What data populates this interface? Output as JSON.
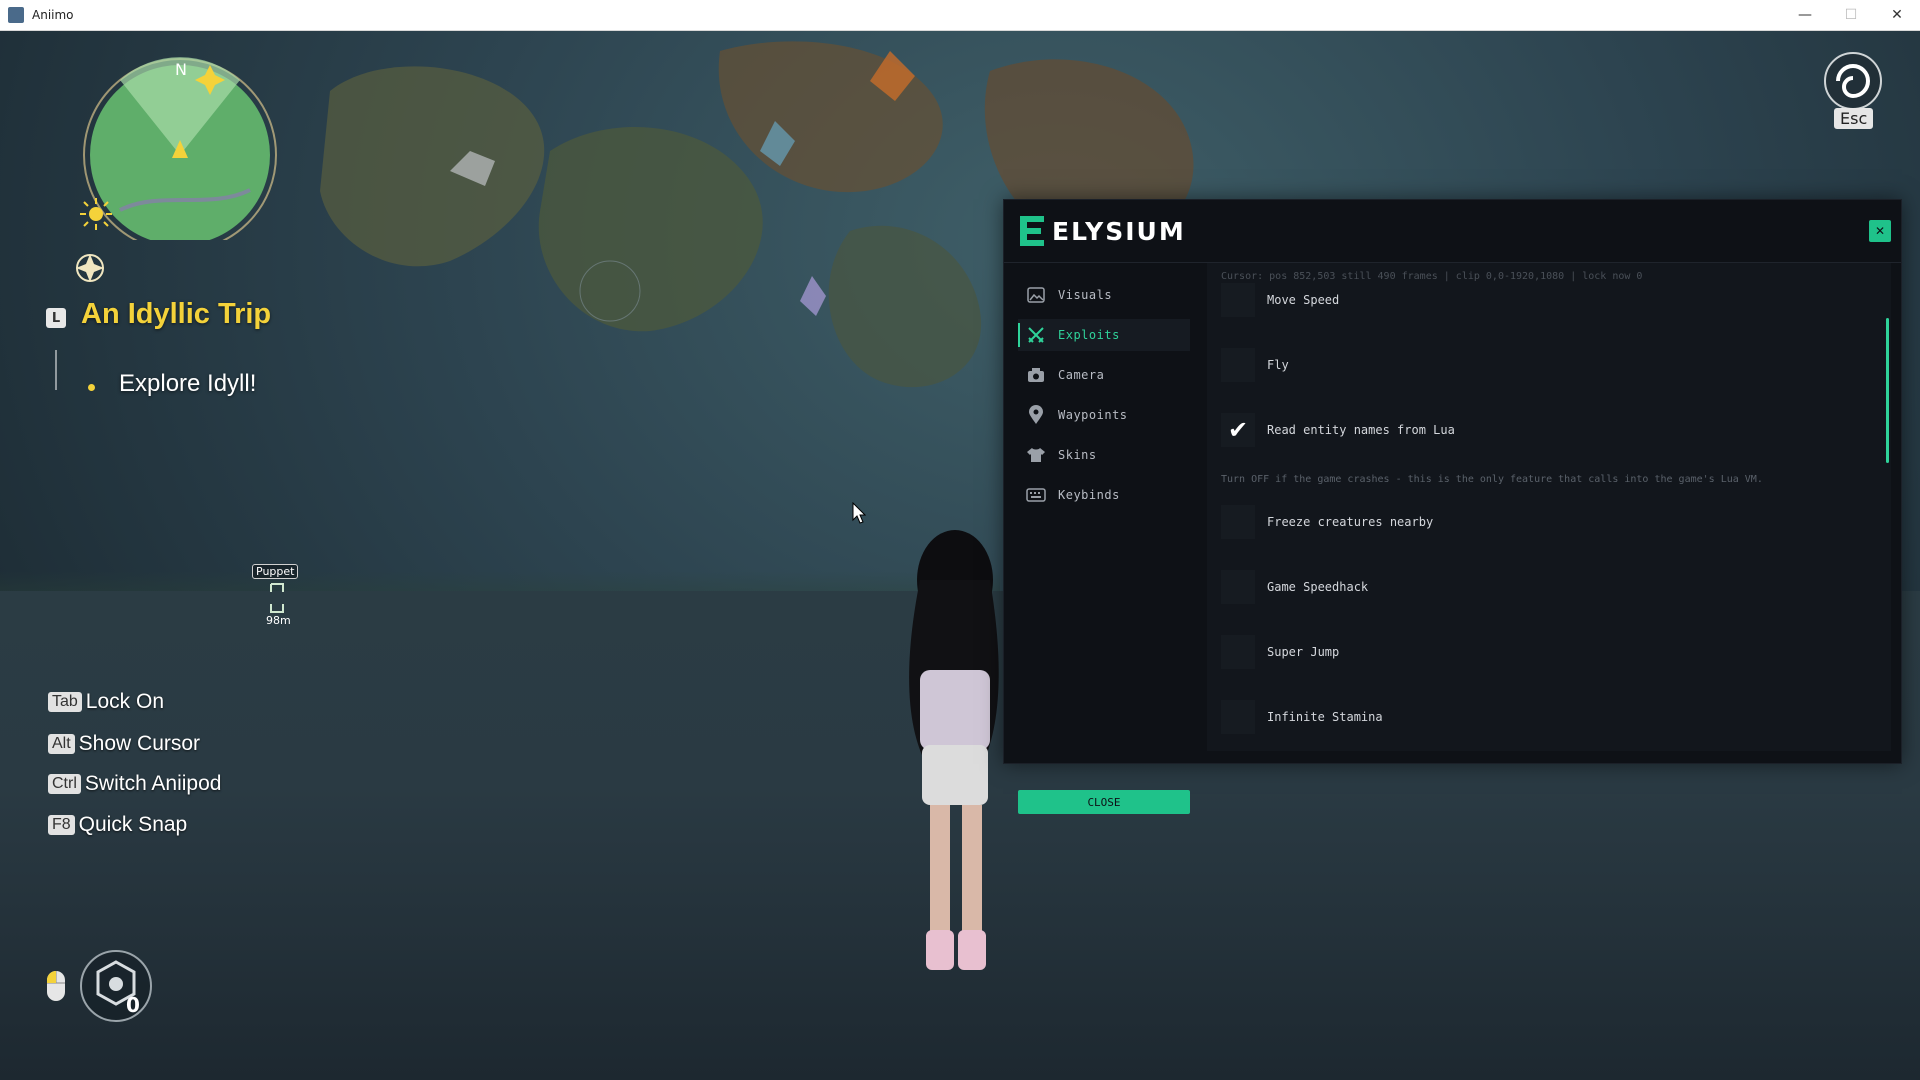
{
  "window": {
    "title": "Aniimo",
    "minimize": "—",
    "maximize": "☐",
    "close": "✕"
  },
  "minimap": {
    "north": "N"
  },
  "quest": {
    "key": "L",
    "title": "An Idyllic Trip",
    "step": "Explore Idyll!"
  },
  "marker": {
    "label": "Puppet",
    "distance": "98m"
  },
  "hints": [
    {
      "key": "Tab",
      "label": "Lock On"
    },
    {
      "key": "Alt",
      "label": "Show Cursor"
    },
    {
      "key": "Ctrl",
      "label": "Switch Aniipod"
    },
    {
      "key": "F8",
      "label": "Quick Snap"
    }
  ],
  "hud": {
    "count": "0"
  },
  "esc": {
    "label": "Esc"
  },
  "panel": {
    "brand": "ELYSIUM",
    "close_x": "✕",
    "close_button": "CLOSE",
    "nav": [
      {
        "label": "Visuals",
        "icon": "image-icon"
      },
      {
        "label": "Exploits",
        "icon": "crossed-swords-icon",
        "active": true
      },
      {
        "label": "Camera",
        "icon": "camera-icon"
      },
      {
        "label": "Waypoints",
        "icon": "map-pin-icon"
      },
      {
        "label": "Skins",
        "icon": "shirt-icon"
      },
      {
        "label": "Keybinds",
        "icon": "keyboard-icon"
      }
    ],
    "debug_text": "Cursor: pos 852,503 still 490 frames | clip 0,0-1920,1080 | lock now 0",
    "options": [
      {
        "label": "Move Speed",
        "checked": false
      },
      {
        "label": "Fly",
        "checked": false
      },
      {
        "label": "Read entity names from Lua",
        "checked": true
      },
      {
        "label": "Freeze creatures nearby",
        "checked": false
      },
      {
        "label": "Game Speedhack",
        "checked": false
      },
      {
        "label": "Super Jump",
        "checked": false
      },
      {
        "label": "Infinite Stamina",
        "checked": false
      }
    ],
    "note": "Turn OFF if the game crashes - this is the only feature that calls into the game's Lua VM.",
    "check_mark": "✔"
  },
  "colors": {
    "accent": "#1fc28a",
    "quest_yellow": "#f4d23a",
    "panel_bg": "#0e1116"
  }
}
